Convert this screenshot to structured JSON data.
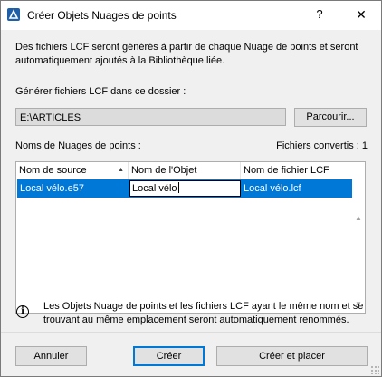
{
  "window": {
    "title": "Créer Objets Nuages de points",
    "help_label": "?",
    "close_label": "✕"
  },
  "info": {
    "text": "Des fichiers LCF seront générés à partir de chaque Nuage de points et seront automatiquement ajoutés à la Bibliothèque liée."
  },
  "folder": {
    "label": "Générer fichiers LCF dans ce dossier :",
    "path": "E:\\ARTICLES",
    "browse_label": "Parcourir..."
  },
  "clouds": {
    "label": "Noms de Nuages de points :",
    "converted": "Fichiers convertis : 1",
    "columns": [
      "Nom de source",
      "Nom de l'Objet",
      "Nom de fichier LCF"
    ],
    "rows": [
      {
        "source": "Local vélo.e57",
        "object": "Local vélo",
        "lcf": "Local vélo.lcf"
      }
    ]
  },
  "note": {
    "icon": "info-icon",
    "text": "Les Objets Nuage de points et les fichiers LCF ayant le même nom et se trouvant au même emplacement seront automatiquement renommés."
  },
  "buttons": {
    "cancel": "Annuler",
    "create": "Créer",
    "create_and_place": "Créer et placer"
  },
  "colors": {
    "selection": "#0078d7",
    "dialog_bg": "#f0f0f0"
  }
}
